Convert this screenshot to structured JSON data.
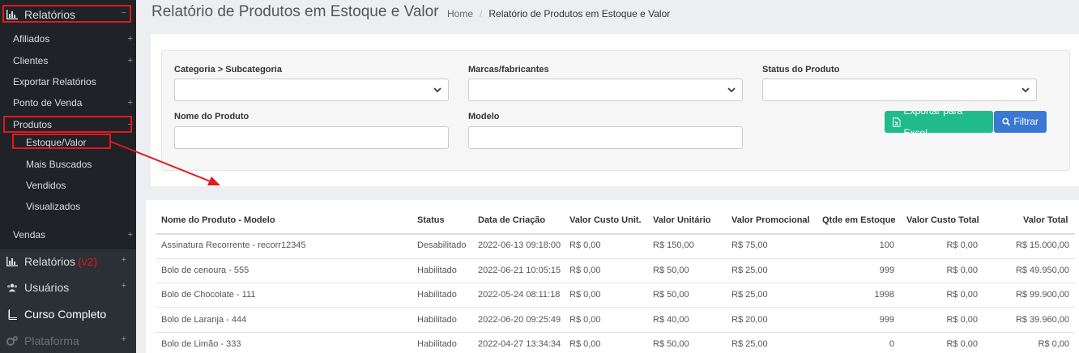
{
  "sidebar": {
    "relatorios": "Relatórios",
    "relatorios_toggle": "−",
    "afiliados": "Afiliados",
    "clientes": "Clientes",
    "exportar": "Exportar Relatórios",
    "ponto_venda": "Ponto de Venda",
    "produtos": "Produtos",
    "produtos_toggle": "−",
    "estoque_valor": "Estoque/Valor",
    "mais_buscados": "Mais Buscados",
    "vendidos": "Vendidos",
    "visualizados": "Visualizados",
    "vendas": "Vendas",
    "relatorios_v2": "Relatórios",
    "v2_tag": "(v2)",
    "usuarios": "Usuários",
    "curso": "Curso Completo",
    "plataforma": "Plataforma",
    "plus": "+"
  },
  "header": {
    "title": "Relatório de Produtos em Estoque e Valor",
    "crumb_home": "Home",
    "crumb_sep": "/",
    "crumb_current": "Relatório de Produtos em Estoque e Valor"
  },
  "filters": {
    "categoria_label": "Categoria > Subcategoria",
    "marcas_label": "Marcas/fabricantes",
    "status_label": "Status do Produto",
    "nome_label": "Nome do Produto",
    "modelo_label": "Modelo",
    "export_button": "Exportar para Excel",
    "filter_button": "Filtrar"
  },
  "table": {
    "headers": [
      "Nome do Produto - Modelo",
      "Status",
      "Data de Criação",
      "Valor Custo Unit.",
      "Valor Unitário",
      "Valor Promocional",
      "Qtde em Estoque",
      "Valor Custo Total",
      "Valor Total"
    ],
    "rows": [
      [
        "Assinatura Recorrente - recorr12345",
        "Desabilitado",
        "2022-06-13 09:18:00",
        "R$ 0,00",
        "R$ 150,00",
        "R$ 75,00",
        "100",
        "R$ 0,00",
        "R$ 15.000,00"
      ],
      [
        "Bolo de cenoura - 555",
        "Habilitado",
        "2022-06-21 10:05:15",
        "R$ 0,00",
        "R$ 50,00",
        "R$ 25,00",
        "999",
        "R$ 0,00",
        "R$ 49.950,00"
      ],
      [
        "Bolo de Chocolate - 111",
        "Habilitado",
        "2022-05-24 08:11:18",
        "R$ 0,00",
        "R$ 50,00",
        "R$ 25,00",
        "1998",
        "R$ 0,00",
        "R$ 99.900,00"
      ],
      [
        "Bolo de Laranja - 444",
        "Habilitado",
        "2022-06-20 09:25:49",
        "R$ 0,00",
        "R$ 40,00",
        "R$ 20,00",
        "999",
        "R$ 0,00",
        "R$ 39.960,00"
      ],
      [
        "Bolo de Limão - 333",
        "Habilitado",
        "2022-04-27 13:34:34",
        "R$ 0,00",
        "R$ 50,00",
        "R$ 25,00",
        "0",
        "R$ 0,00",
        "R$ 0,00"
      ]
    ]
  },
  "colors": {
    "sidebar": "#2b2f36",
    "highlight": "#e0191e",
    "green": "#21ba8a",
    "blue": "#3a78d4"
  }
}
